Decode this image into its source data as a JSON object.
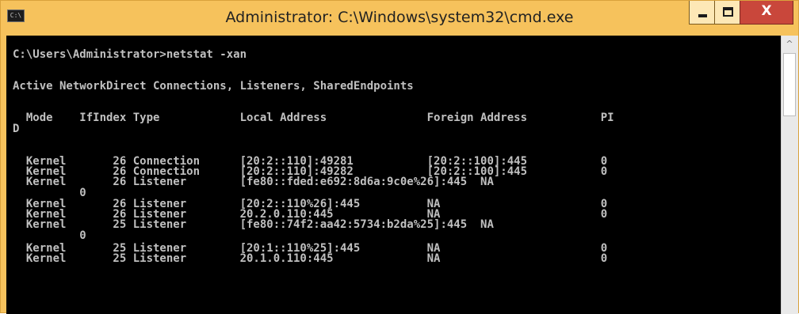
{
  "window": {
    "title": "Administrator: C:\\Windows\\system32\\cmd.exe",
    "icon": "cmd-window-icon",
    "icon_glyph": "C:\\",
    "controls": {
      "minimize_icon": "minimize-icon",
      "maximize_icon": "maximize-icon",
      "close_label": "X"
    }
  },
  "console": {
    "prompt_line": "C:\\Users\\Administrator>netstat -xan",
    "heading_line": "Active NetworkDirect Connections, Listeners, SharedEndpoints",
    "header_line": "  Mode    IfIndex Type            Local Address               Foreign Address           PI",
    "header_wrap": "D",
    "rows": [
      "  Kernel       26 Connection      [20:2::110]:49281           [20:2::100]:445           0",
      "  Kernel       26 Connection      [20:2::110]:49282           [20:2::100]:445           0",
      "  Kernel       26 Listener        [fe80::fded:e692:8d6a:9c0e%26]:445  NA",
      "          0",
      "  Kernel       26 Listener        [20:2::110%26]:445          NA                        0",
      "  Kernel       26 Listener        20.2.0.110:445              NA                        0",
      "  Kernel       25 Listener        [fe80::74f2:aa42:5734:b2da%25]:445  NA",
      "          0",
      "  Kernel       25 Listener        [20:1::110%25]:445          NA                        0",
      "  Kernel       25 Listener        20.1.0.110:445              NA                        0"
    ]
  },
  "scrollbar": {
    "up_arrow_icon": "scroll-up-arrow-icon"
  },
  "colors": {
    "titlebar": "#f6c25c",
    "console_bg": "#000000",
    "console_text": "#c0c0c0",
    "close_button": "#c9473b"
  }
}
